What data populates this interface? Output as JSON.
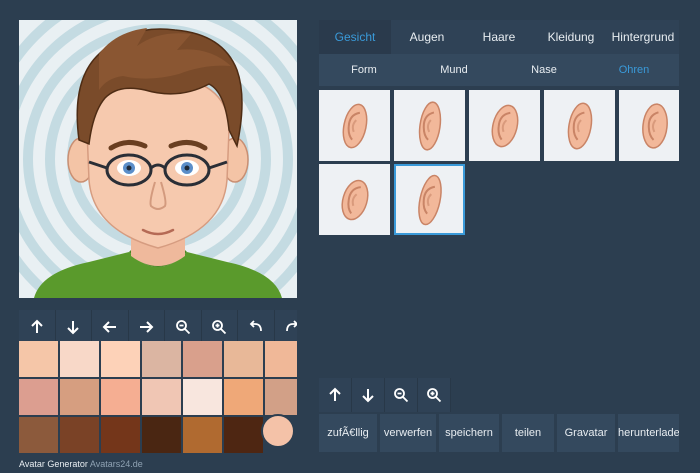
{
  "footer": {
    "title": "Avatar Generator",
    "site": "Avatars24.de"
  },
  "main_tabs": [
    {
      "label": "Gesicht",
      "active": true
    },
    {
      "label": "Augen",
      "active": false
    },
    {
      "label": "Haare",
      "active": false
    },
    {
      "label": "Kleidung",
      "active": false
    },
    {
      "label": "Hintergrund",
      "active": false
    }
  ],
  "sub_tabs": [
    {
      "label": "Form",
      "active": false
    },
    {
      "label": "Mund",
      "active": false
    },
    {
      "label": "Nase",
      "active": false
    },
    {
      "label": "Ohren",
      "active": true
    }
  ],
  "ear_options": [
    "ear-1",
    "ear-2",
    "ear-3",
    "ear-4",
    "ear-5",
    "ear-6",
    "ear-7"
  ],
  "selected_ear_option": 7,
  "actions": [
    {
      "label": "zufÃ€llig"
    },
    {
      "label": "verwerfen"
    },
    {
      "label": "speichern"
    },
    {
      "label": "teilen"
    },
    {
      "label": "Gravatar"
    },
    {
      "label": "herunterladen"
    }
  ],
  "left_tools": [
    "arrow-up-icon",
    "arrow-down-icon",
    "arrow-left-icon",
    "arrow-right-icon",
    "zoom-out-icon",
    "zoom-in-icon",
    "undo-icon",
    "redo-icon"
  ],
  "right_tools": [
    "arrow-up-icon",
    "arrow-down-icon",
    "zoom-out-icon",
    "zoom-in-icon"
  ],
  "skin_colors": [
    [
      "#f5c6a8",
      "#f8d8c8",
      "#fdd2b8",
      "#dbb5a2",
      "#d9a08c",
      "#e8b898",
      "#f0b898"
    ],
    [
      "#dc9e90",
      "#d69e80",
      "#f5ae92",
      "#f0c6b4",
      "#f8e6de",
      "#efa878",
      "#d2a087"
    ],
    [
      "#8c5a3c",
      "#7a4226",
      "#74361a",
      "#4a2612",
      "#b06a30",
      "#4e2612"
    ]
  ],
  "selected_color": "#f4c2a8",
  "colors": {
    "accent": "#3a9ad9",
    "background": "#2c3e50",
    "panel": "#34495e"
  }
}
